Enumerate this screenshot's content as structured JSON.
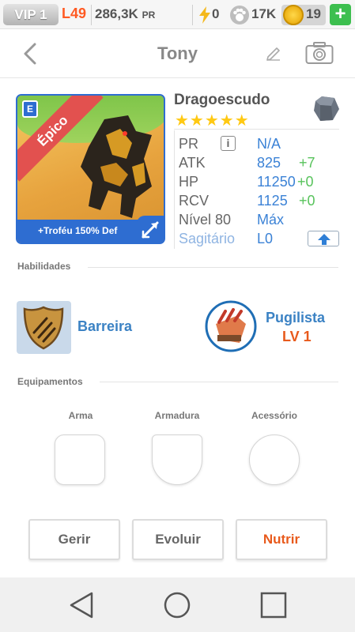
{
  "status": {
    "vip": "VIP 1",
    "level": "L49",
    "power": "286,3K",
    "power_unit": "PR",
    "energy": "0",
    "paws": "17K",
    "coins": "19",
    "add_label": "+"
  },
  "header": {
    "title": "Tony"
  },
  "monster": {
    "name": "Dragoescudo",
    "rarity": "Épico",
    "element_tag": "E",
    "bonus": "+Troféu 150% Def",
    "stars": "★★★★★",
    "stats": {
      "pr_label": "PR",
      "pr_value": "N/A",
      "atk_label": "ATK",
      "atk_value": "825",
      "atk_bonus": "+7",
      "hp_label": "HP",
      "hp_value": "11250",
      "hp_bonus": "+0",
      "rcv_label": "RCV",
      "rcv_value": "1125",
      "rcv_bonus": "+0",
      "level_label": "Nível 80",
      "level_value": "Máx",
      "sign_label": "Sagitário",
      "sign_value": "L0"
    }
  },
  "skills": {
    "heading": "Habilidades",
    "items": [
      {
        "name": "Barreira"
      },
      {
        "name": "Pugilista",
        "level": "LV 1"
      }
    ]
  },
  "equipment": {
    "heading": "Equipamentos",
    "slots": [
      "Arma",
      "Armadura",
      "Acessório"
    ]
  },
  "actions": {
    "manage": "Gerir",
    "evolve": "Evoluir",
    "feed": "Nutrir"
  },
  "colors": {
    "accent_blue": "#3b82d6",
    "accent_orange": "#e85a1c",
    "bonus_green": "#58c35c",
    "star": "#ffc913"
  }
}
